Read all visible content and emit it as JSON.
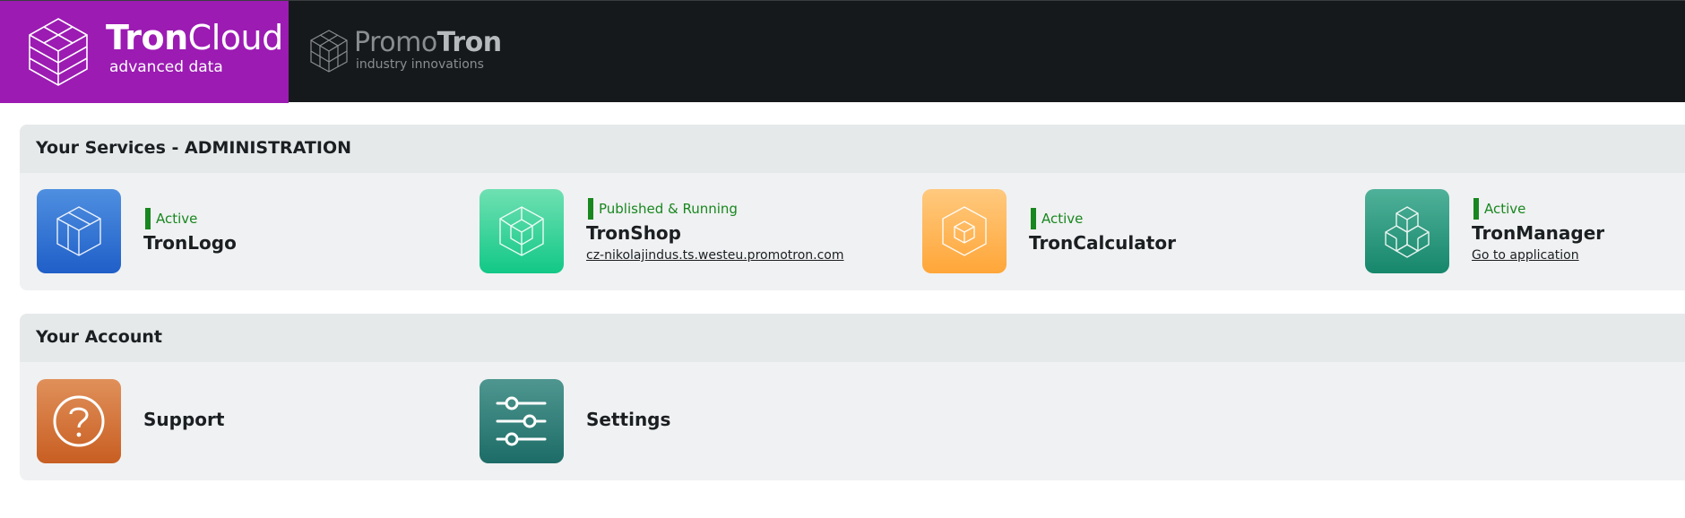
{
  "header": {
    "tron_cloud": {
      "name_bold": "Tron",
      "name_light": "Cloud",
      "tagline": "advanced data"
    },
    "promotron": {
      "name_light": "Promo",
      "name_bold": "Tron",
      "tagline": "industry innovations"
    },
    "accent_color": "#9c1bb3"
  },
  "services": {
    "title": "Your Services - ADMINISTRATION",
    "items": [
      {
        "status": "Active",
        "name": "TronLogo",
        "icon": "cube-icon"
      },
      {
        "status": "Published & Running",
        "name": "TronShop",
        "link": "cz-nikolajindus.ts.westeu.promotron.com",
        "icon": "nested-cube-icon"
      },
      {
        "status": "Active",
        "name": "TronCalculator",
        "icon": "hexagon-cube-icon"
      },
      {
        "status": "Active",
        "name": "TronManager",
        "link": "Go to application",
        "icon": "stacked-cubes-icon"
      }
    ]
  },
  "account": {
    "title": "Your Account",
    "items": [
      {
        "name": "Support",
        "icon": "question-circle-icon"
      },
      {
        "name": "Settings",
        "icon": "sliders-icon"
      }
    ]
  },
  "colors": {
    "status_green": "#18871f",
    "header_bg": "#16191c"
  }
}
